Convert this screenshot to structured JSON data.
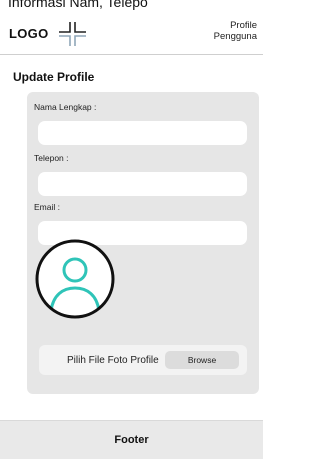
{
  "caption": "Informasi Nam, Telepo",
  "header": {
    "logo_text": "LOGO",
    "logo_icon": "cross-grid-icon",
    "profile_line1": "Profile",
    "profile_line2": "Pengguna"
  },
  "page_title": "Update Profile",
  "form": {
    "name_label": "Nama Lengkap :",
    "name_value": "",
    "phone_label": "Telepon :",
    "phone_value": "",
    "email_label": "Email :",
    "email_value": "",
    "avatar_icon": "user-avatar-icon",
    "file_label": "Pilih File Foto Profile",
    "browse_label": "Browse"
  },
  "footer": {
    "label": "Footer"
  },
  "colors": {
    "card_bg": "#e6e6e6",
    "input_bg": "#ffffff",
    "avatar_accent": "#2fc4b8",
    "footer_bg": "#e9e9e9"
  }
}
